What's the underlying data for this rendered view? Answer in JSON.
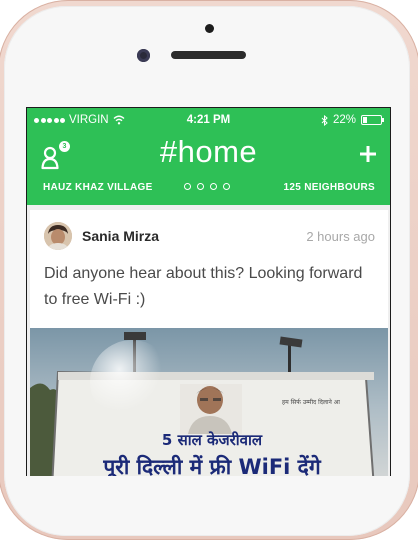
{
  "status_bar": {
    "carrier": "VIRGIN",
    "time": "4:21 PM",
    "battery_text": "22%",
    "battery_level": 0.22
  },
  "header": {
    "title": "#home",
    "notification_count": "3",
    "location": "HAUZ KHAZ VILLAGE",
    "neighbours": "125 NEIGHBOURS",
    "accent_color": "#2ec056"
  },
  "post": {
    "author": "Sania Mirza",
    "time_ago": "2 hours ago",
    "text": "Did anyone hear about this? Looking forward to free Wi-Fi :)",
    "image": {
      "line1": "5 साल केजरीवाल",
      "line2": "पूरी दिल्ली में फ्री WiFi देंगे",
      "small_text": "हम सिर्फ उम्मीद दिलाने आ"
    }
  }
}
